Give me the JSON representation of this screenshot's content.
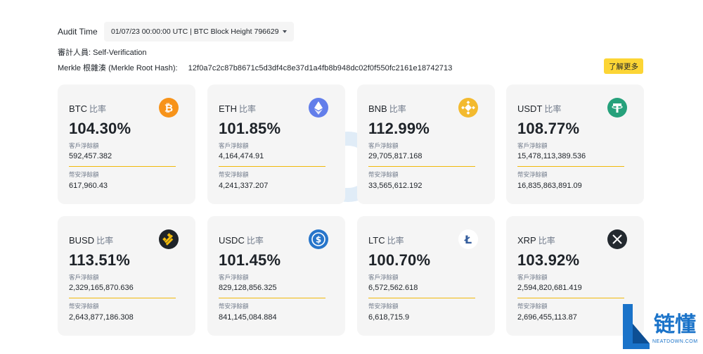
{
  "audit": {
    "label": "Audit Time",
    "selected": "01/07/23 00:00:00 UTC | BTC Block Height 796629"
  },
  "auditor": "審計人員: Self-Verification",
  "merkle": {
    "label": "Merkle 根雜湊 (Merkle Root Hash):",
    "hash": "12f0a7c2c87b8671c5d3df4c8e37d1a4fb8b948dc02f0f550fc2161e18742713"
  },
  "learn_more": "了解更多",
  "labels": {
    "ratio": "比率",
    "customer": "客戶淨餘額",
    "platform": "幣安淨餘額"
  },
  "cards": [
    {
      "coin": "BTC",
      "pct": "104.30%",
      "customer": "592,457.382",
      "platform": "617,960.43",
      "icon": "btc-icon",
      "color": "#f7931a"
    },
    {
      "coin": "ETH",
      "pct": "101.85%",
      "customer": "4,164,474.91",
      "platform": "4,241,337.207",
      "icon": "eth-icon",
      "color": "#627eea"
    },
    {
      "coin": "BNB",
      "pct": "112.99%",
      "customer": "29,705,817.168",
      "platform": "33,565,612.192",
      "icon": "bnb-icon",
      "color": "#f3ba2f"
    },
    {
      "coin": "USDT",
      "pct": "108.77%",
      "customer": "15,478,113,389.536",
      "platform": "16,835,863,891.09",
      "icon": "usdt-icon",
      "color": "#26a17b"
    },
    {
      "coin": "BUSD",
      "pct": "113.51%",
      "customer": "2,329,165,870.636",
      "platform": "2,643,877,186.308",
      "icon": "busd-icon",
      "color": "#1e2329"
    },
    {
      "coin": "USDC",
      "pct": "101.45%",
      "customer": "829,128,856.325",
      "platform": "841,145,084.884",
      "icon": "usdc-icon",
      "color": "#2775ca"
    },
    {
      "coin": "LTC",
      "pct": "100.70%",
      "customer": "6,572,562.618",
      "platform": "6,618,715.9",
      "icon": "ltc-icon",
      "color": "#ffffff"
    },
    {
      "coin": "XRP",
      "pct": "103.92%",
      "customer": "2,594,820,681.419",
      "platform": "2,696,455,113.87",
      "icon": "xrp-icon",
      "color": "#23292f"
    }
  ],
  "brand": {
    "name": "链懂",
    "url": "NEATDOWN.COM"
  },
  "colors": {
    "accent": "#fcd535",
    "divider": "#f0b90b",
    "card_bg": "#f5f5f5"
  }
}
